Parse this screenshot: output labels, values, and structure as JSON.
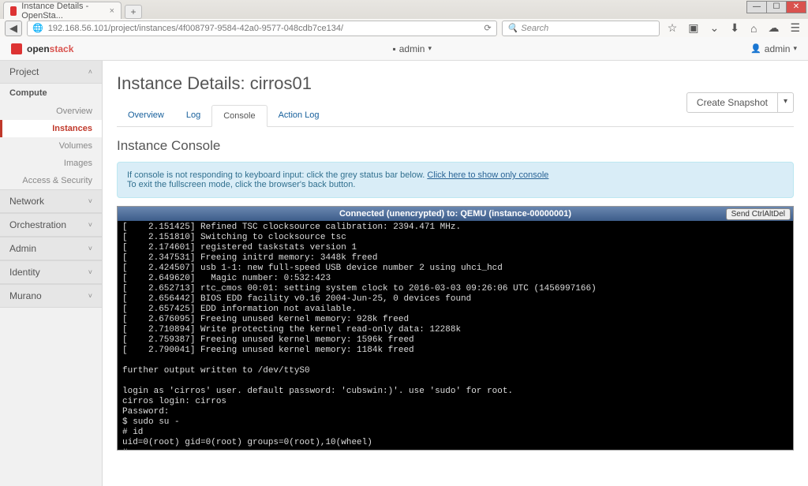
{
  "browser": {
    "tab_title": "Instance Details - OpenSta...",
    "url": "192.168.56.101/project/instances/4f008797-9584-42a0-9577-048cdb7ce134/",
    "search_placeholder": "Search"
  },
  "header": {
    "brand_a": "open",
    "brand_b": "stack",
    "center": "admin",
    "user": "admin"
  },
  "sidebar": {
    "project": "Project",
    "compute": "Compute",
    "items": [
      "Overview",
      "Instances",
      "Volumes",
      "Images",
      "Access & Security"
    ],
    "network": "Network",
    "orchestration": "Orchestration",
    "admin": "Admin",
    "identity": "Identity",
    "murano": "Murano"
  },
  "page": {
    "title": "Instance Details: cirros01",
    "snapshot": "Create Snapshot"
  },
  "tabs": {
    "overview": "Overview",
    "log": "Log",
    "console": "Console",
    "action": "Action Log"
  },
  "section_title": "Instance Console",
  "notice": {
    "l1": "If console is not responding to keyboard input: click the grey status bar below. ",
    "link": "Click here to show only console",
    "l2": "To exit the fullscreen mode, click the browser's back button."
  },
  "titlebar": "Connected (unencrypted) to: QEMU (instance-00000001)",
  "send_btn": "Send CtrlAltDel",
  "console_text": "[    2.151425] Refined TSC clocksource calibration: 2394.471 MHz.\n[    2.151810] Switching to clocksource tsc\n[    2.174601] registered taskstats version 1\n[    2.347531] Freeing initrd memory: 3448k freed\n[    2.424507] usb 1-1: new full-speed USB device number 2 using uhci_hcd\n[    2.649620]   Magic number: 0:532:423\n[    2.652713] rtc_cmos 00:01: setting system clock to 2016-03-03 09:26:06 UTC (1456997166)\n[    2.656442] BIOS EDD facility v0.16 2004-Jun-25, 0 devices found\n[    2.657425] EDD information not available.\n[    2.676095] Freeing unused kernel memory: 928k freed\n[    2.710894] Write protecting the kernel read-only data: 12288k\n[    2.759387] Freeing unused kernel memory: 1596k freed\n[    2.790041] Freeing unused kernel memory: 1184k freed\n\nfurther output written to /dev/ttyS0\n\nlogin as 'cirros' user. default password: 'cubswin:)'. use 'sudo' for root.\ncirros login: cirros\nPassword:\n$ sudo su -\n# id\nuid=0(root) gid=0(root) groups=0(root),10(wheel)\n# _"
}
